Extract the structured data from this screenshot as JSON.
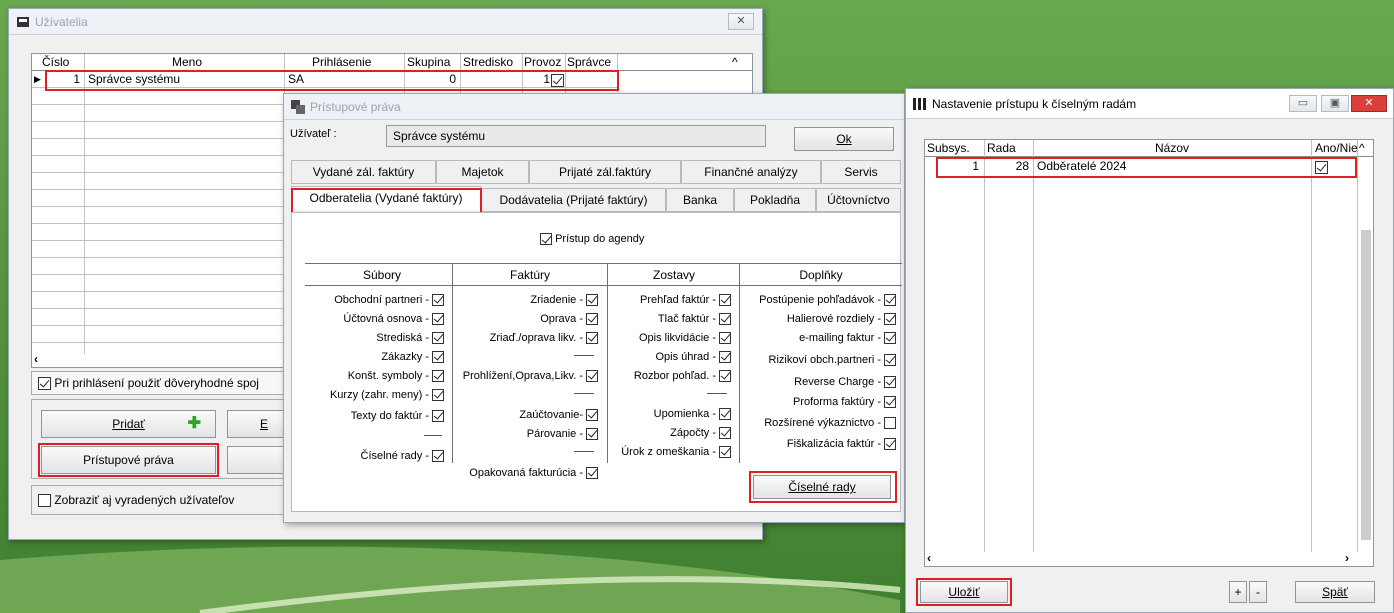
{
  "users_window": {
    "title": "Užívatelia",
    "columns": [
      "Číslo",
      "Meno",
      "Prihlásenie",
      "Skupina",
      "Stredisko",
      "Provoz",
      "Správce"
    ],
    "row": {
      "cislo": "1",
      "meno": "Správce systému",
      "prihlasenie": "SA",
      "skupina": "0",
      "stredisko": "",
      "provoz": "1",
      "spravce": true
    },
    "trust_check_label": "Pri prihlásení použiť dôveryhodné spoj",
    "add_label": "Pridať",
    "edit_label": "E",
    "rights_label": "Prístupové práva",
    "show_retired_label": "Zobraziť aj vyradených užívateľov"
  },
  "rights_window": {
    "title": "Prístupové práva",
    "user_label": "Užívateľ :",
    "user_value": "Správce systému",
    "ok_label": "Ok",
    "tabs_row1": [
      "Vydané zál. faktúry",
      "Majetok",
      "Prijaté zál.faktúry",
      "Finančné analýzy",
      "Servis"
    ],
    "tabs_row2": [
      "Odberatelia (Vydané faktúry)",
      "Dodávatelia (Prijaté faktúry)",
      "Banka",
      "Pokladňa",
      "Účtovníctvo"
    ],
    "access_label": "Prístup do agendy",
    "groups": {
      "subory": {
        "title": "Súbory",
        "items": [
          "Obchodní partneri -",
          "Účtovná osnova -",
          "Strediská -",
          "Zákazky -",
          "Konšt. symboly -",
          "Kurzy (zahr. meny) -",
          "Texty do faktúr -",
          "Číselné rady -"
        ]
      },
      "faktury": {
        "title": "Faktúry",
        "items": [
          "Zriadenie -",
          "Oprava -",
          "Zriaď./oprava likv. -",
          "Prohlížení,Oprava,Likv. -",
          "Zaúčtovanie-",
          "Párovanie -",
          "Opakovaná fakturúcia -"
        ]
      },
      "zostavy": {
        "title": "Zostavy",
        "items": [
          "Prehľad faktúr -",
          "Tlač faktúr -",
          "Opis likvidácie -",
          "Opis úhrad -",
          "Rozbor pohľad. -",
          "Upomienka -",
          "Zápočty -",
          "Úrok z omeškania -"
        ]
      },
      "doplnky": {
        "title": "Doplňky",
        "items": [
          "Postúpenie pohľadávok -",
          "Halierové rozdiely -",
          "e-mailing faktur -",
          "Rizikoví obch.partneri -",
          "Reverse Charge -",
          "Proforma faktúry -",
          "Rozšírené výkaznictvo -",
          "Fiškalizácia faktúr -"
        ]
      }
    },
    "number_series_label": "Číselné rady"
  },
  "series_window": {
    "title": "Nastavenie prístupu k číselným radám",
    "columns": [
      "Subsys.",
      "Rada",
      "Názov",
      "Ano/Nie"
    ],
    "row": {
      "subsys": "1",
      "rada": "28",
      "nazov": "Odběratelé 2024",
      "ano": true
    },
    "save_label": "Uložiť",
    "plus_label": "+",
    "minus_label": "-",
    "back_label": "Späť"
  },
  "colors": {
    "highlight": "#e02020",
    "desktop": "#4f8f3c"
  }
}
